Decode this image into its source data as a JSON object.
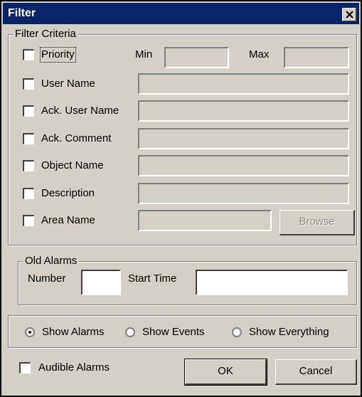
{
  "title": "Filter",
  "criteria": {
    "legend": "Filter Criteria",
    "priority_label": "Priority",
    "min_label": "Min",
    "max_label": "Max",
    "min_value": "",
    "max_value": "",
    "rows": [
      {
        "label": "User Name",
        "value": ""
      },
      {
        "label": "Ack. User Name",
        "value": ""
      },
      {
        "label": "Ack. Comment",
        "value": ""
      },
      {
        "label": "Object Name",
        "value": ""
      },
      {
        "label": "Description",
        "value": ""
      },
      {
        "label": "Area Name",
        "value": ""
      }
    ],
    "browse_label": "Browse"
  },
  "old_alarms": {
    "legend": "Old Alarms",
    "number_label": "Number",
    "start_time_label": "Start Time",
    "number_value": "",
    "start_time_value": ""
  },
  "show": {
    "options": [
      "Show Alarms",
      "Show Events",
      "Show Everything"
    ],
    "selected": "Show Alarms"
  },
  "audible_label": "Audible Alarms",
  "ok_label": "OK",
  "cancel_label": "Cancel",
  "colors": {
    "titlebar": "#0a246a",
    "face": "#d4d0c8"
  },
  "icons": {
    "close": "close-icon"
  }
}
